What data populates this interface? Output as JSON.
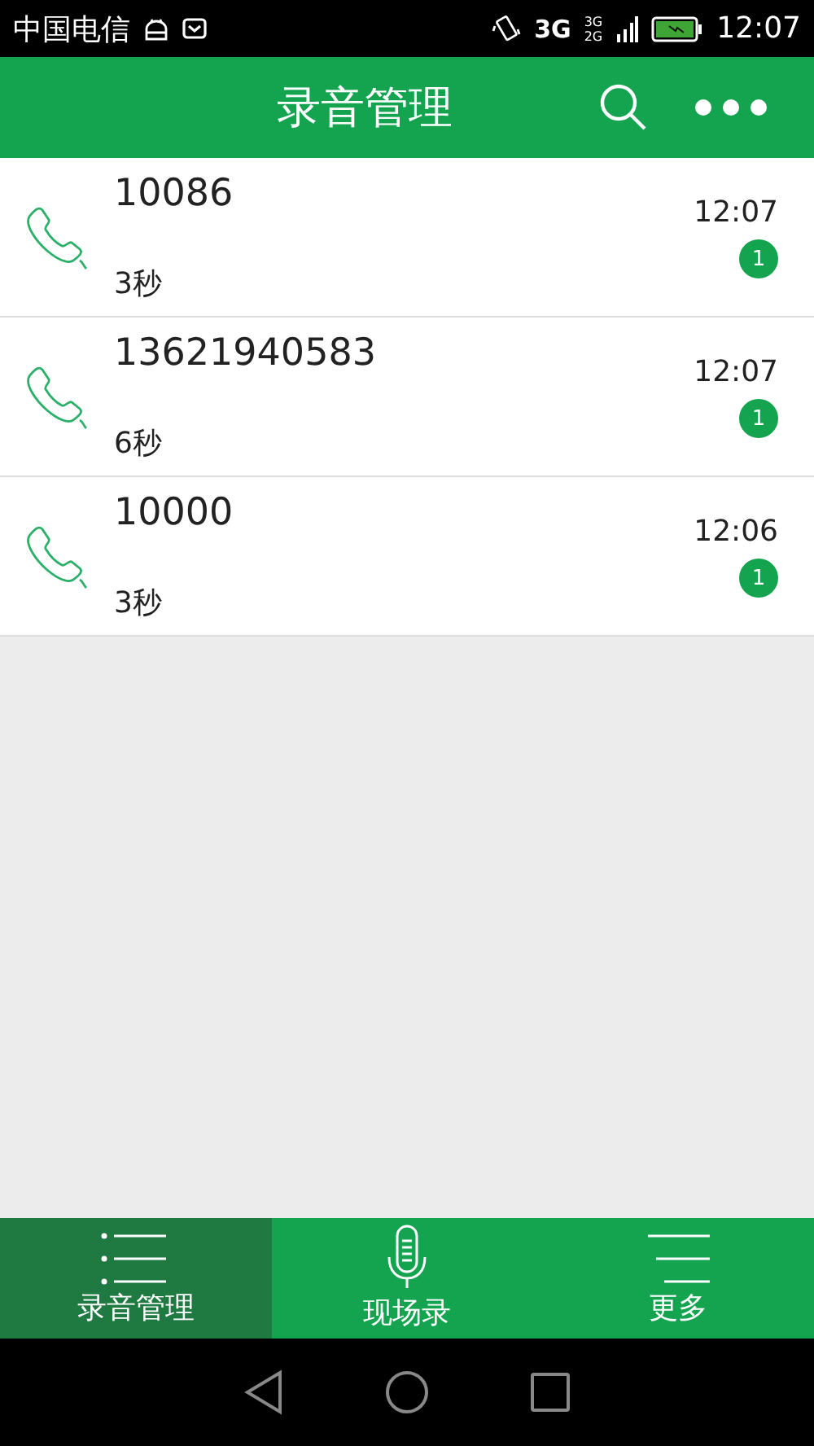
{
  "status_bar": {
    "carrier": "中国电信",
    "network": "3G",
    "network_dual_top": "3G",
    "network_dual_bottom": "2G",
    "time": "12:07"
  },
  "app_bar": {
    "title": "录音管理"
  },
  "recordings": [
    {
      "number": "10086",
      "duration": "3秒",
      "time": "12:07",
      "count": "1"
    },
    {
      "number": "13621940583",
      "duration": "6秒",
      "time": "12:07",
      "count": "1"
    },
    {
      "number": "10000",
      "duration": "3秒",
      "time": "12:06",
      "count": "1"
    }
  ],
  "tabs": [
    {
      "label": "录音管理",
      "kind": "list",
      "selected": true
    },
    {
      "label": "现场录",
      "kind": "mic",
      "selected": false
    },
    {
      "label": "更多",
      "kind": "more",
      "selected": false
    }
  ]
}
